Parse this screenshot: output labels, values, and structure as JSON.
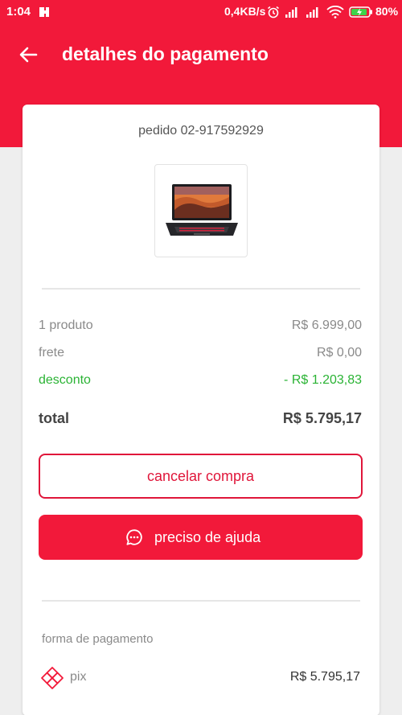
{
  "status_bar": {
    "time": "1:04",
    "network_speed": "0,4KB/s",
    "battery_pct": "80%"
  },
  "app_bar": {
    "title": "detalhes do pagamento"
  },
  "order": {
    "id_label": "pedido 02-917592929",
    "product_image": "laptop-image"
  },
  "summary": {
    "product_label": "1 produto",
    "product_value": "R$ 6.999,00",
    "shipping_label": "frete",
    "shipping_value": "R$ 0,00",
    "discount_label": "desconto",
    "discount_value": "- R$ 1.203,83",
    "total_label": "total",
    "total_value": "R$ 5.795,17"
  },
  "actions": {
    "cancel_label": "cancelar compra",
    "help_label": "preciso de ajuda",
    "help_icon": "chat-icon"
  },
  "payment": {
    "section_label": "forma de pagamento",
    "method": "pix",
    "method_icon": "pix-icon",
    "amount": "R$ 5.795,17"
  },
  "colors": {
    "brand": "#f2193a",
    "discount": "#2ab334"
  }
}
